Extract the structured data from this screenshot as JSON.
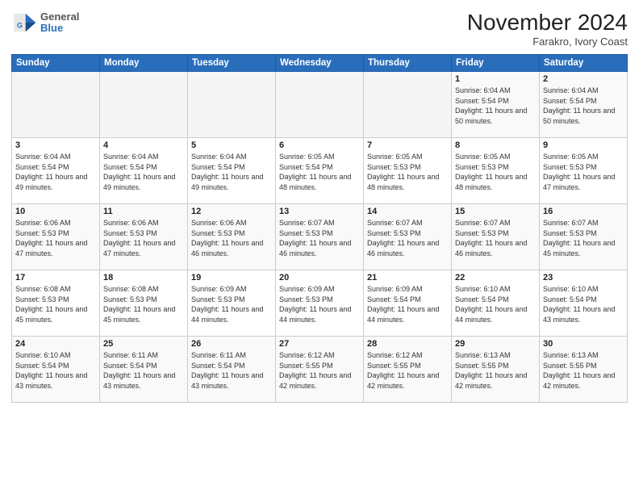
{
  "header": {
    "logo": {
      "general": "General",
      "blue": "Blue"
    },
    "title": "November 2024",
    "location": "Farakro, Ivory Coast"
  },
  "weekdays": [
    "Sunday",
    "Monday",
    "Tuesday",
    "Wednesday",
    "Thursday",
    "Friday",
    "Saturday"
  ],
  "weeks": [
    [
      {
        "day": null
      },
      {
        "day": null
      },
      {
        "day": null
      },
      {
        "day": null
      },
      {
        "day": null
      },
      {
        "day": 1,
        "sunrise": "6:04 AM",
        "sunset": "5:54 PM",
        "daylight": "11 hours and 50 minutes."
      },
      {
        "day": 2,
        "sunrise": "6:04 AM",
        "sunset": "5:54 PM",
        "daylight": "11 hours and 50 minutes."
      }
    ],
    [
      {
        "day": 3,
        "sunrise": "6:04 AM",
        "sunset": "5:54 PM",
        "daylight": "11 hours and 49 minutes."
      },
      {
        "day": 4,
        "sunrise": "6:04 AM",
        "sunset": "5:54 PM",
        "daylight": "11 hours and 49 minutes."
      },
      {
        "day": 5,
        "sunrise": "6:04 AM",
        "sunset": "5:54 PM",
        "daylight": "11 hours and 49 minutes."
      },
      {
        "day": 6,
        "sunrise": "6:05 AM",
        "sunset": "5:54 PM",
        "daylight": "11 hours and 48 minutes."
      },
      {
        "day": 7,
        "sunrise": "6:05 AM",
        "sunset": "5:53 PM",
        "daylight": "11 hours and 48 minutes."
      },
      {
        "day": 8,
        "sunrise": "6:05 AM",
        "sunset": "5:53 PM",
        "daylight": "11 hours and 48 minutes."
      },
      {
        "day": 9,
        "sunrise": "6:05 AM",
        "sunset": "5:53 PM",
        "daylight": "11 hours and 47 minutes."
      }
    ],
    [
      {
        "day": 10,
        "sunrise": "6:06 AM",
        "sunset": "5:53 PM",
        "daylight": "11 hours and 47 minutes."
      },
      {
        "day": 11,
        "sunrise": "6:06 AM",
        "sunset": "5:53 PM",
        "daylight": "11 hours and 47 minutes."
      },
      {
        "day": 12,
        "sunrise": "6:06 AM",
        "sunset": "5:53 PM",
        "daylight": "11 hours and 46 minutes."
      },
      {
        "day": 13,
        "sunrise": "6:07 AM",
        "sunset": "5:53 PM",
        "daylight": "11 hours and 46 minutes."
      },
      {
        "day": 14,
        "sunrise": "6:07 AM",
        "sunset": "5:53 PM",
        "daylight": "11 hours and 46 minutes."
      },
      {
        "day": 15,
        "sunrise": "6:07 AM",
        "sunset": "5:53 PM",
        "daylight": "11 hours and 46 minutes."
      },
      {
        "day": 16,
        "sunrise": "6:07 AM",
        "sunset": "5:53 PM",
        "daylight": "11 hours and 45 minutes."
      }
    ],
    [
      {
        "day": 17,
        "sunrise": "6:08 AM",
        "sunset": "5:53 PM",
        "daylight": "11 hours and 45 minutes."
      },
      {
        "day": 18,
        "sunrise": "6:08 AM",
        "sunset": "5:53 PM",
        "daylight": "11 hours and 45 minutes."
      },
      {
        "day": 19,
        "sunrise": "6:09 AM",
        "sunset": "5:53 PM",
        "daylight": "11 hours and 44 minutes."
      },
      {
        "day": 20,
        "sunrise": "6:09 AM",
        "sunset": "5:53 PM",
        "daylight": "11 hours and 44 minutes."
      },
      {
        "day": 21,
        "sunrise": "6:09 AM",
        "sunset": "5:54 PM",
        "daylight": "11 hours and 44 minutes."
      },
      {
        "day": 22,
        "sunrise": "6:10 AM",
        "sunset": "5:54 PM",
        "daylight": "11 hours and 44 minutes."
      },
      {
        "day": 23,
        "sunrise": "6:10 AM",
        "sunset": "5:54 PM",
        "daylight": "11 hours and 43 minutes."
      }
    ],
    [
      {
        "day": 24,
        "sunrise": "6:10 AM",
        "sunset": "5:54 PM",
        "daylight": "11 hours and 43 minutes."
      },
      {
        "day": 25,
        "sunrise": "6:11 AM",
        "sunset": "5:54 PM",
        "daylight": "11 hours and 43 minutes."
      },
      {
        "day": 26,
        "sunrise": "6:11 AM",
        "sunset": "5:54 PM",
        "daylight": "11 hours and 43 minutes."
      },
      {
        "day": 27,
        "sunrise": "6:12 AM",
        "sunset": "5:55 PM",
        "daylight": "11 hours and 42 minutes."
      },
      {
        "day": 28,
        "sunrise": "6:12 AM",
        "sunset": "5:55 PM",
        "daylight": "11 hours and 42 minutes."
      },
      {
        "day": 29,
        "sunrise": "6:13 AM",
        "sunset": "5:55 PM",
        "daylight": "11 hours and 42 minutes."
      },
      {
        "day": 30,
        "sunrise": "6:13 AM",
        "sunset": "5:55 PM",
        "daylight": "11 hours and 42 minutes."
      }
    ]
  ]
}
